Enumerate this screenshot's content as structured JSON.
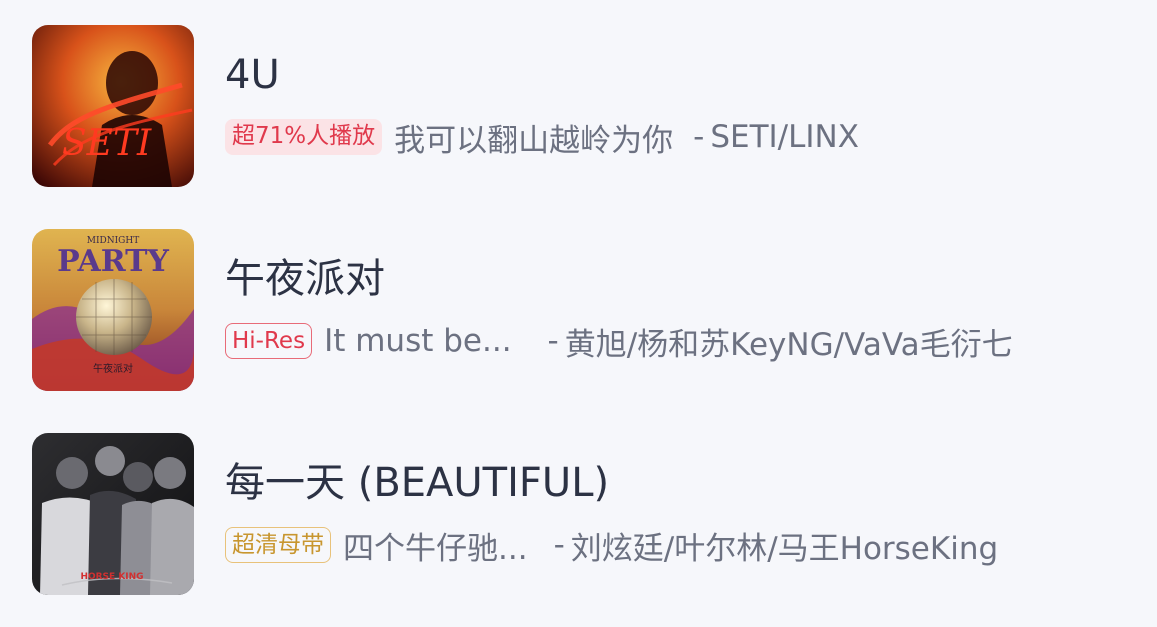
{
  "songs": [
    {
      "title": "4U",
      "badge": "超71%人播放",
      "badge_type": "hot",
      "description": "我可以翻山越岭为你",
      "separator": "-",
      "artists": "SETI/LINX",
      "cover": {
        "lettering": "SETI",
        "palette": [
          "#f29a2e",
          "#c33b13",
          "#4a0b07"
        ]
      }
    },
    {
      "title": "午夜派对",
      "badge": "Hi-Res",
      "badge_type": "hires",
      "description": "It must be...",
      "separator": "-",
      "artists": "黄旭/杨和苏KeyNG/VaVa毛衍七",
      "cover": {
        "lettering_top": "MIDNIGHT",
        "lettering": "PARTY",
        "lettering_bottom": "午夜派对",
        "palette": [
          "#d6a13c",
          "#7a2b8c",
          "#c23a24"
        ]
      }
    },
    {
      "title": "每一天 (BEAUTIFUL)",
      "badge": "超清母带",
      "badge_type": "master",
      "description": "四个牛仔驰...",
      "separator": "-",
      "artists": "刘炫廷/叶尔林/马王HorseKing",
      "cover": {
        "lettering": "HORSE KING",
        "palette": [
          "#1b1b1d",
          "#4a4a4f",
          "#b32626"
        ]
      }
    }
  ],
  "colors": {
    "background": "#f6f7fb",
    "title": "#2c3244",
    "subtitle": "#6c7181",
    "badge_red": "#e0394c",
    "badge_gold": "#c8962f"
  }
}
